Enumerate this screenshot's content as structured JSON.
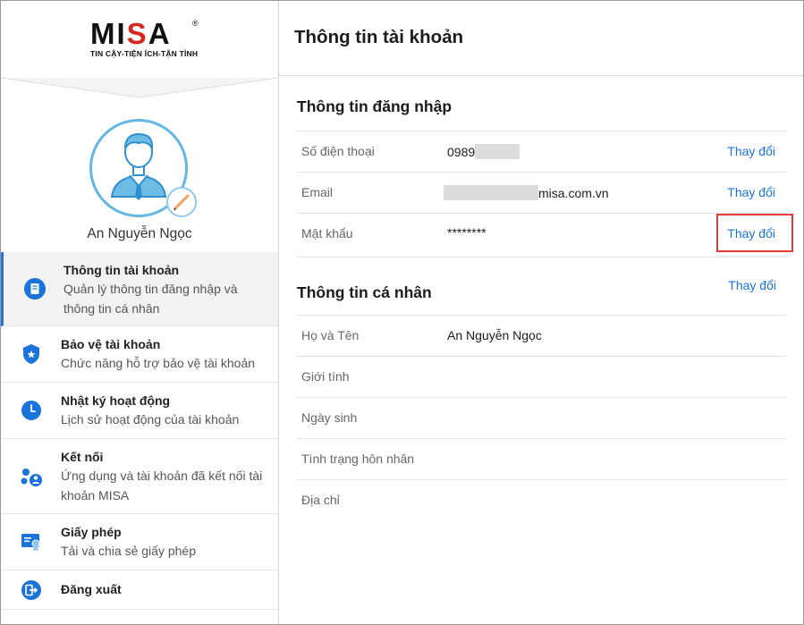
{
  "brand": {
    "logo_text_pre": "MI",
    "logo_text_s": "S",
    "logo_text_post": "A",
    "registered": "®",
    "tagline": "TIN CẬY-TIỆN ÍCH-TẬN TÌNH",
    "accent_color": "#d7281f"
  },
  "user": {
    "name": "An Nguyễn Ngọc"
  },
  "sidebar": {
    "items": [
      {
        "title": "Thông tin tài khoản",
        "desc1": "Quản lý thông tin đăng nhập và",
        "desc2": "thông tin cá nhân",
        "icon": "account-info-icon"
      },
      {
        "title": "Bảo vệ tài khoản",
        "desc1": "Chức năng hỗ trợ bảo vệ tài khoản",
        "icon": "shield-icon"
      },
      {
        "title": "Nhật ký hoạt động",
        "desc1": "Lịch sử hoạt động của tài khoản",
        "icon": "clock-icon"
      },
      {
        "title": "Kết nối",
        "desc1": "Ứng dụng và tài khoản đã kết nối tài",
        "desc2": "khoản MISA",
        "icon": "connections-icon"
      },
      {
        "title": "Giấy phép",
        "desc1": "Tải và chia sẻ giấy phép",
        "icon": "license-icon"
      },
      {
        "title": "Đăng xuất",
        "icon": "logout-icon"
      }
    ]
  },
  "main": {
    "title": "Thông tin tài khoản",
    "login_section": {
      "title": "Thông tin đăng nhập",
      "rows": [
        {
          "label": "Số điện thoại",
          "value": "0989",
          "action": "Thay đổi"
        },
        {
          "label": "Email",
          "value": "misa.com.vn",
          "action": "Thay đổi"
        },
        {
          "label": "Mật khẩu",
          "value": "********",
          "action": "Thay đổi"
        }
      ]
    },
    "personal_section": {
      "title": "Thông tin cá nhân",
      "action": "Thay đổi",
      "rows": [
        {
          "label": "Họ và Tên",
          "value": "An Nguyễn Ngọc"
        },
        {
          "label": "Giới tính",
          "value": ""
        },
        {
          "label": "Ngày sinh",
          "value": ""
        },
        {
          "label": "Tình trạng hôn nhân",
          "value": ""
        },
        {
          "label": "Địa chỉ",
          "value": ""
        }
      ]
    }
  },
  "colors": {
    "link": "#1a73d9",
    "icon_blue": "#1a73d9",
    "active_border": "#2b73d2",
    "highlight": "#e53935"
  }
}
